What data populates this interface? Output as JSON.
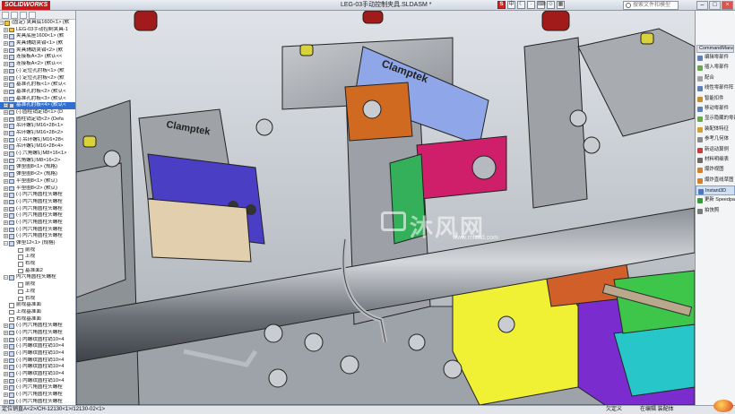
{
  "titlebar": {
    "app_logo": "SOLIDWORKS",
    "title": "LEG-03手动控制夹具.SLDASM *",
    "search_placeholder": "搜索文件和模型",
    "toolbar_icons": [
      "s-icon",
      "chinese-input-icon",
      "moon-icon",
      "punctuation-icon",
      "keyboard-icon",
      "user-icon",
      "grid-icon"
    ]
  },
  "tree": {
    "items": [
      {
        "label": "(固定) 夹具底1600<1> (默",
        "indent": 1,
        "expanded": true,
        "icon": "assembly"
      },
      {
        "label": "LEG-03手动控制夹具-1",
        "indent": 2,
        "expanded": false,
        "icon": "assembly"
      },
      {
        "label": "夹具底座1600<1> (默",
        "indent": 2,
        "expanded": false,
        "icon": "part"
      },
      {
        "label": "夹具辅助夹钳<1> (默",
        "indent": 2,
        "expanded": false,
        "icon": "part"
      },
      {
        "label": "夹具辅助夹钳<2> (默",
        "indent": 2,
        "expanded": false,
        "icon": "part"
      },
      {
        "label": "连接板A<3> (默认<<",
        "indent": 2,
        "expanded": false,
        "icon": "part"
      },
      {
        "label": "连接板A<2> (默认<<",
        "indent": 2,
        "expanded": false,
        "icon": "part"
      },
      {
        "label": "(-) 定位孔肘板<1> (默",
        "indent": 2,
        "expanded": false,
        "icon": "part"
      },
      {
        "label": "(-) 定位孔肘板<2> (默",
        "indent": 2,
        "expanded": false,
        "icon": "part"
      },
      {
        "label": "基准孔肘板<1> (默认<",
        "indent": 2,
        "expanded": false,
        "icon": "part"
      },
      {
        "label": "基准孔肘板<2> (默认<",
        "indent": 2,
        "expanded": false,
        "icon": "part"
      },
      {
        "label": "基准孔肘板<3> (默认<",
        "indent": 2,
        "expanded": false,
        "icon": "part"
      },
      {
        "label": "基准孔肘板<4> (默认<",
        "indent": 2,
        "expanded": false,
        "icon": "part",
        "selected": true
      },
      {
        "label": "(-) 圆柱销定销<1> (D",
        "indent": 2,
        "expanded": false,
        "icon": "part"
      },
      {
        "label": "圆柱销定销<2> (Defa",
        "indent": 2,
        "expanded": false,
        "icon": "part"
      },
      {
        "label": "吊环螺钉M16×28<1>",
        "indent": 2,
        "expanded": false,
        "icon": "part"
      },
      {
        "label": "吊环螺钉M16×28<2>",
        "indent": 2,
        "expanded": false,
        "icon": "part"
      },
      {
        "label": "(-) 吊环螺钉M16×28<",
        "indent": 2,
        "expanded": false,
        "icon": "part"
      },
      {
        "label": "吊环螺钉M16×28<4>",
        "indent": 2,
        "expanded": false,
        "icon": "part"
      },
      {
        "label": "(-) 六角螺钉M8×16<1>",
        "indent": 2,
        "expanded": false,
        "icon": "part"
      },
      {
        "label": "六角螺钉M8×16<2>",
        "indent": 2,
        "expanded": false,
        "icon": "part"
      },
      {
        "label": "弹垫圈8<1> (规格)",
        "indent": 2,
        "expanded": false,
        "icon": "part"
      },
      {
        "label": "弹垫圈8<2> (规格)",
        "indent": 2,
        "expanded": false,
        "icon": "part"
      },
      {
        "label": "平垫圈8<1> (默认)",
        "indent": 2,
        "expanded": false,
        "icon": "part"
      },
      {
        "label": "平垫圈8<2> (默认)",
        "indent": 2,
        "expanded": false,
        "icon": "part"
      },
      {
        "label": "(-) 内六角圆柱头螺栓",
        "indent": 2,
        "expanded": false,
        "icon": "part"
      },
      {
        "label": "(-) 内六角圆柱头螺栓",
        "indent": 2,
        "expanded": false,
        "icon": "part"
      },
      {
        "label": "(-) 内六角圆柱头螺栓",
        "indent": 2,
        "expanded": false,
        "icon": "part"
      },
      {
        "label": "(-) 内六角圆柱头螺栓",
        "indent": 2,
        "expanded": false,
        "icon": "part"
      },
      {
        "label": "(-) 内六角圆柱头螺栓",
        "indent": 2,
        "expanded": false,
        "icon": "part"
      },
      {
        "label": "(-) 内六角圆柱头螺栓",
        "indent": 2,
        "expanded": false,
        "icon": "part"
      },
      {
        "label": "(-) 内六角圆柱头螺栓",
        "indent": 2,
        "expanded": false,
        "icon": "part"
      },
      {
        "label": "弹垫12<1> (规格)",
        "indent": 2,
        "expanded": true,
        "icon": "part"
      },
      {
        "label": "前视",
        "indent": 4,
        "icon": "plane"
      },
      {
        "label": "上视",
        "indent": 4,
        "icon": "plane"
      },
      {
        "label": "右视",
        "indent": 4,
        "icon": "plane"
      },
      {
        "label": "基准面2",
        "indent": 4,
        "icon": "plane"
      },
      {
        "label": "内六角圆柱头螺栓",
        "indent": 2,
        "expanded": true,
        "icon": "part"
      },
      {
        "label": "前视",
        "indent": 4,
        "icon": "plane"
      },
      {
        "label": "上视",
        "indent": 4,
        "icon": "plane"
      },
      {
        "label": "右视",
        "indent": 4,
        "icon": "plane"
      },
      {
        "label": "前视基准面",
        "indent": 2,
        "icon": "plane"
      },
      {
        "label": "上视基准面",
        "indent": 2,
        "icon": "plane"
      },
      {
        "label": "右视基准面",
        "indent": 2,
        "icon": "plane"
      },
      {
        "label": "(-) 内六角圆柱头螺栓",
        "indent": 2,
        "expanded": false,
        "icon": "part"
      },
      {
        "label": "(-) 内六角圆柱头螺栓",
        "indent": 2,
        "expanded": false,
        "icon": "part"
      },
      {
        "label": "(-) 内螺纹圆柱销10×4",
        "indent": 2,
        "expanded": false,
        "icon": "part"
      },
      {
        "label": "(-) 内螺纹圆柱销10×4",
        "indent": 2,
        "expanded": false,
        "icon": "part"
      },
      {
        "label": "(-) 内螺纹圆柱销10×4",
        "indent": 2,
        "expanded": false,
        "icon": "part"
      },
      {
        "label": "(-) 内螺纹圆柱销10×4",
        "indent": 2,
        "expanded": false,
        "icon": "part"
      },
      {
        "label": "(-) 内螺纹圆柱销10×4",
        "indent": 2,
        "expanded": false,
        "icon": "part"
      },
      {
        "label": "(-) 内螺纹圆柱销10×4",
        "indent": 2,
        "expanded": false,
        "icon": "part"
      },
      {
        "label": "(-) 内螺纹圆柱销10×4",
        "indent": 2,
        "expanded": false,
        "icon": "part"
      },
      {
        "label": "(-) 内六角圆柱头螺栓",
        "indent": 2,
        "expanded": false,
        "icon": "part"
      },
      {
        "label": "(-) 内六角圆柱头螺栓",
        "indent": 2,
        "expanded": false,
        "icon": "part"
      },
      {
        "label": "(-) 内六角圆柱头螺栓",
        "indent": 2,
        "expanded": false,
        "icon": "part"
      }
    ]
  },
  "command_panel": {
    "header": "CommandMana",
    "items": [
      {
        "label": "编辑零部件",
        "color": "#5f7fb5"
      },
      {
        "label": "插入零部件",
        "color": "#6aa84f"
      },
      {
        "label": "配合",
        "color": "#a0a0a0"
      },
      {
        "label": "线性零部件阵",
        "color": "#5f7fb5"
      },
      {
        "label": "智能扣件",
        "color": "#c09030"
      },
      {
        "label": "移动零部件",
        "color": "#5f7fb5"
      },
      {
        "label": "显示隐藏的零部",
        "color": "#6aa84f"
      },
      {
        "label": "装配体特征",
        "color": "#d0a030"
      },
      {
        "label": "参考几何体",
        "color": "#8a8a8a"
      },
      {
        "label": "新运动算例",
        "color": "#c04040"
      },
      {
        "label": "材料明细表",
        "color": "#6a6a6a"
      },
      {
        "label": "爆炸视图",
        "color": "#d08030"
      },
      {
        "label": "爆炸直线草图",
        "color": "#d08030"
      },
      {
        "label": "Instant3D",
        "color": "#4a78c8",
        "highlighted": true
      },
      {
        "label": "更新 Speedpa",
        "color": "#3a9a3a"
      },
      {
        "label": "拍快照",
        "color": "#7a7a7a"
      }
    ]
  },
  "viewport": {
    "clamp_label_1": "Clamptek",
    "clamp_label_2": "Clamptek",
    "watermark_text": "沐风网",
    "watermark_url": "www.mfcad.com"
  },
  "statusbar": {
    "left": "定位销直A<2>/CH-12130<1>/12130-02<1>",
    "right1": "欠定义",
    "right2": "在编辑 装配体"
  }
}
